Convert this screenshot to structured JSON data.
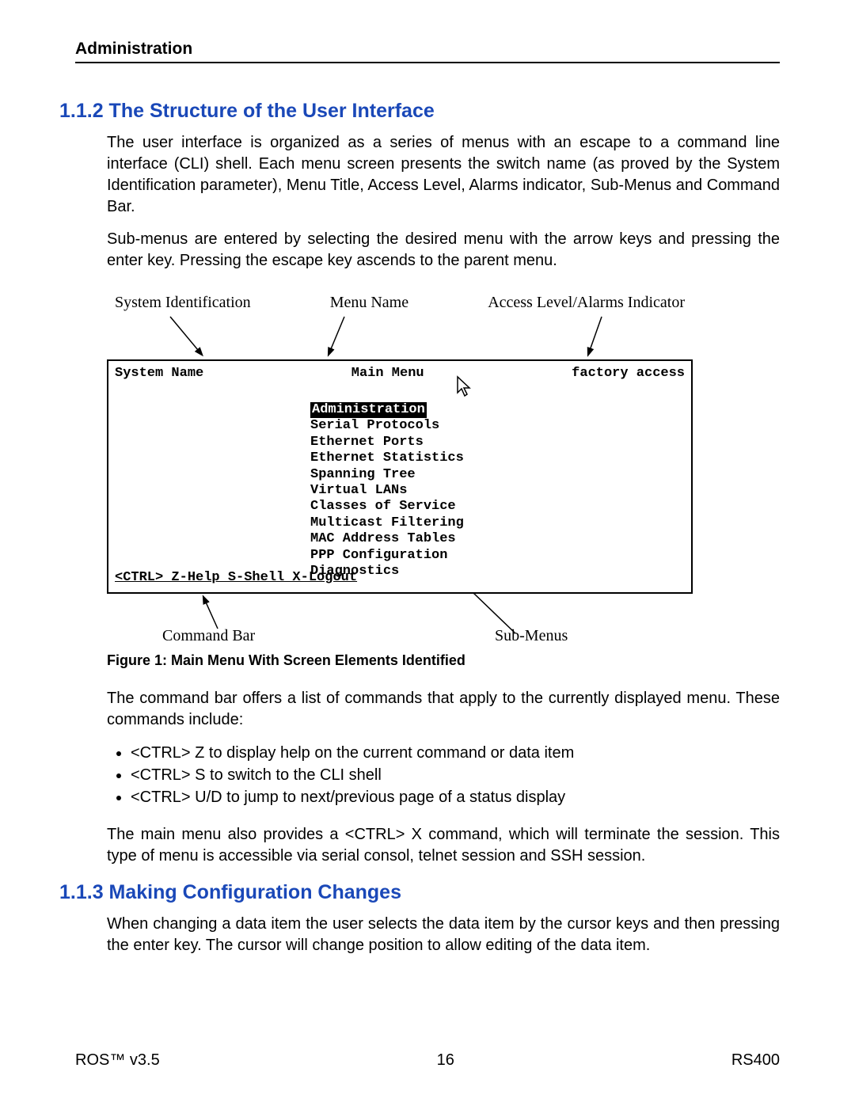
{
  "header": {
    "title": "Administration"
  },
  "sec112": {
    "heading": "1.1.2  The Structure of the User Interface",
    "p1": "The user interface is organized as a series of menus with an escape to a command line interface (CLI) shell. Each menu screen presents the switch name (as proved by the System Identification parameter), Menu Title, Access Level, Alarms indicator, Sub-Menus and Command Bar.",
    "p2": "Sub-menus are entered by selecting the desired menu with the arrow keys and pressing the enter key. Pressing the escape key ascends to the parent menu.",
    "p3": "The command bar offers a list of commands that apply to the currently displayed menu. These commands include:",
    "p4": "The main menu also provides a <CTRL> X command, which will terminate the session. This type of menu is accessible via serial consol, telnet session and SSH session."
  },
  "callouts": {
    "sysid": "System Identification",
    "menuname": "Menu Name",
    "access": "Access Level/Alarms Indicator",
    "cmdbar": "Command Bar",
    "submenus": "Sub-Menus"
  },
  "terminal": {
    "sysname": "System Name",
    "title": "Main Menu",
    "access": "factory access",
    "menu_selected": "Administration",
    "menu_items": [
      "Serial Protocols",
      "Ethernet Ports",
      "Ethernet Statistics",
      "Spanning Tree",
      "Virtual LANs",
      "Classes of Service",
      "Multicast Filtering",
      "MAC Address Tables",
      "PPP Configuration",
      "Diagnostics"
    ],
    "cmdbar": "<CTRL>  Z-Help S-Shell X-Logout"
  },
  "figcap": "Figure 1: Main Menu With Screen Elements Identified",
  "cmds": [
    "<CTRL> Z to display help on the current command or data item",
    "<CTRL> S to switch to the CLI shell",
    "<CTRL> U/D to jump to next/previous page of a status display"
  ],
  "sec113": {
    "heading": "1.1.3  Making Configuration Changes",
    "p1": "When changing a data item the user selects the data item by the cursor keys and then pressing the enter key. The cursor will change position to allow editing of the data item."
  },
  "footer": {
    "left": "ROS™ v3.5",
    "center": "16",
    "right": "RS400"
  }
}
